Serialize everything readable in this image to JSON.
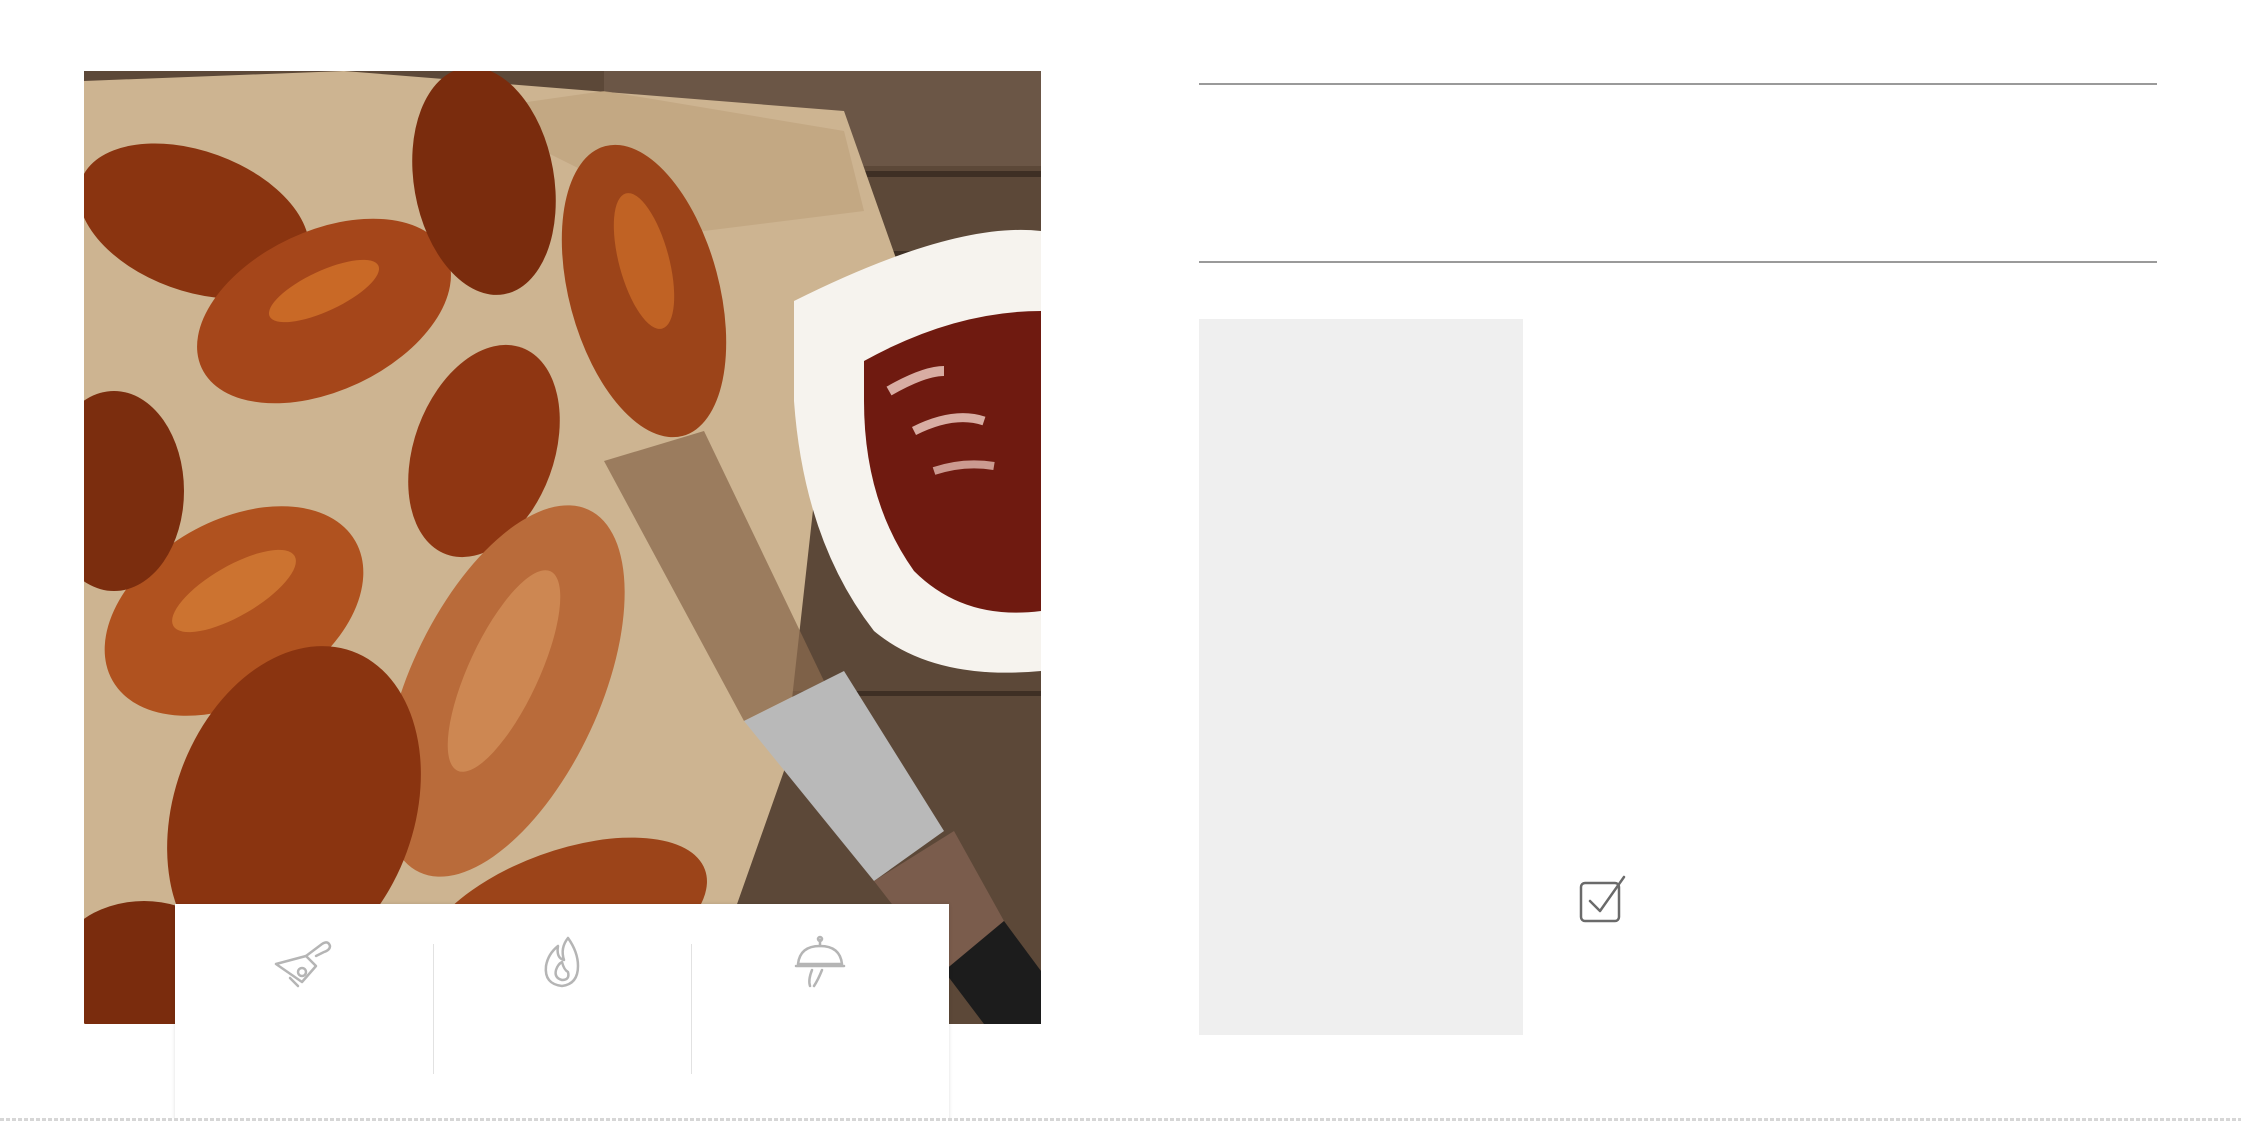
{
  "hero": {
    "alt_description": "",
    "colors": {
      "wood": "#5a4636",
      "paper": "#cdb491",
      "wing_glaze": "#8a3410",
      "wing_highlight": "#d9772c",
      "sauce": "#6f1a10",
      "bowl": "#f6f3ee"
    }
  },
  "info_card": {
    "items": [
      {
        "icon": "prep-knife-icon",
        "value": ""
      },
      {
        "icon": "flame-icon",
        "value": ""
      },
      {
        "icon": "serving-cloche-icon",
        "value": ""
      }
    ]
  },
  "recipe": {
    "title": "",
    "ingredients_panel_color": "#efefef",
    "directions": {
      "checkbox_icon": "checkbox-checked-icon",
      "checkbox_label": ""
    }
  }
}
